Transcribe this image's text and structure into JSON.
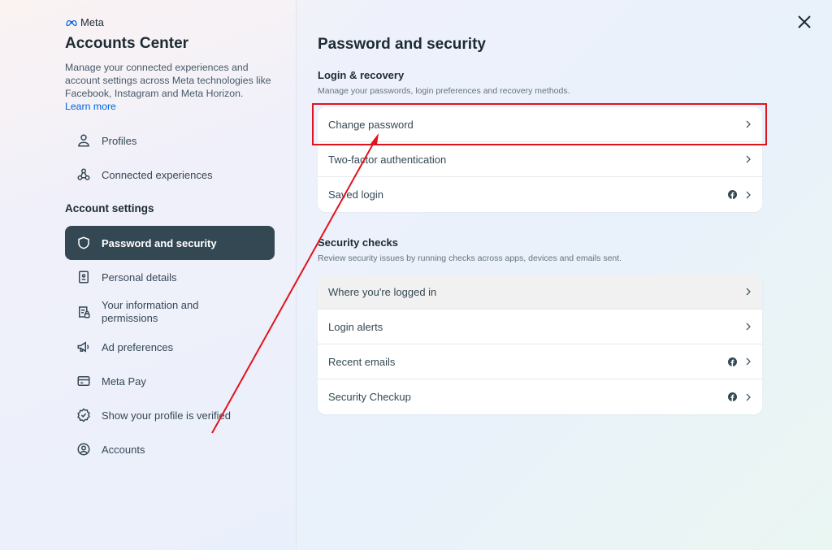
{
  "brand": {
    "name": "Meta",
    "logo_icon": "meta-infinity-icon"
  },
  "sidebar": {
    "title": "Accounts Center",
    "description": "Manage your connected experiences and account settings across Meta technologies like Facebook, Instagram and Meta Horizon.",
    "learn_more": "Learn more",
    "top_items": [
      {
        "label": "Profiles",
        "icon": "person-icon"
      },
      {
        "label": "Connected experiences",
        "icon": "connected-nodes-icon"
      }
    ],
    "section_label": "Account settings",
    "items": [
      {
        "label": "Password and security",
        "icon": "shield-icon",
        "active": true
      },
      {
        "label": "Personal details",
        "icon": "id-card-icon"
      },
      {
        "label": "Your information and permissions",
        "icon": "document-lock-icon"
      },
      {
        "label": "Ad preferences",
        "icon": "megaphone-icon"
      },
      {
        "label": "Meta Pay",
        "icon": "credit-card-icon"
      },
      {
        "label": "Show your profile is verified",
        "icon": "verified-badge-icon"
      },
      {
        "label": "Accounts",
        "icon": "account-circle-icon"
      }
    ]
  },
  "main": {
    "title": "Password and security",
    "close_icon": "close-icon",
    "sections": [
      {
        "heading": "Login & recovery",
        "description": "Manage your passwords, login preferences and recovery methods.",
        "rows": [
          {
            "label": "Change password",
            "facebook_badge": false,
            "highlighted": true
          },
          {
            "label": "Two-factor authentication",
            "facebook_badge": false
          },
          {
            "label": "Saved login",
            "facebook_badge": true
          }
        ]
      },
      {
        "heading": "Security checks",
        "description": "Review security issues by running checks across apps, devices and emails sent.",
        "rows": [
          {
            "label": "Where you're logged in",
            "facebook_badge": false,
            "hover": true
          },
          {
            "label": "Login alerts",
            "facebook_badge": false
          },
          {
            "label": "Recent emails",
            "facebook_badge": true
          },
          {
            "label": "Security Checkup",
            "facebook_badge": true
          }
        ]
      }
    ]
  },
  "annotation": {
    "highlight_color": "#e0141e",
    "target": "Change password"
  },
  "colors": {
    "active_nav_bg": "#344854",
    "link": "#0064e0",
    "meta_blue": "#0064e0"
  }
}
